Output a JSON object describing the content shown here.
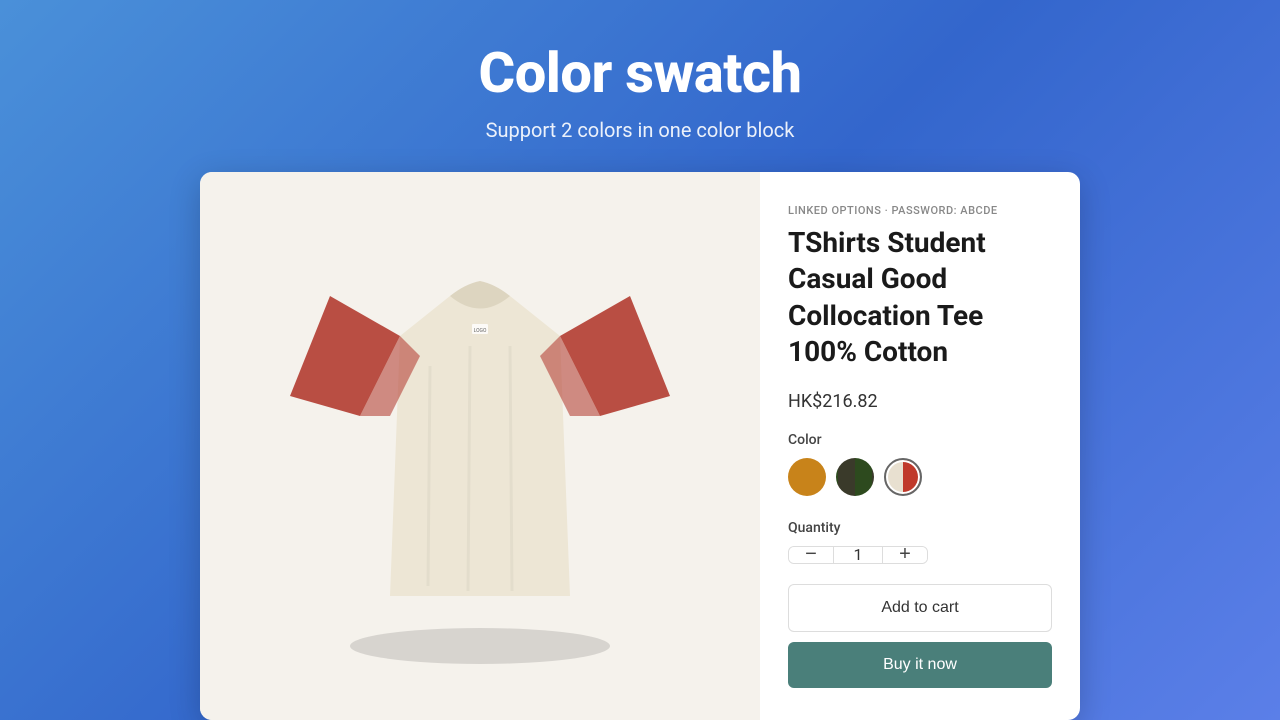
{
  "header": {
    "title": "Color swatch",
    "subtitle": "Support 2 colors in one color block"
  },
  "product": {
    "linked_label": "LINKED OPTIONS · PASSWORD: ABCDE",
    "title": "TShirts Student Casual Good Collocation Tee 100% Cotton",
    "price": "HK$216.82",
    "color_label": "Color",
    "quantity_label": "Quantity",
    "quantity_value": "1",
    "swatches": [
      {
        "id": "orange",
        "color": "#c8831a",
        "label": "Orange",
        "selected": false
      },
      {
        "id": "dark-green",
        "color": "dual-green",
        "label": "Dark Green",
        "selected": false
      },
      {
        "id": "red-cream",
        "color": "dual-red-cream",
        "label": "Red Cream",
        "selected": true
      }
    ],
    "add_to_cart_label": "Add to cart",
    "buy_now_label": "Buy it now",
    "qty_minus": "−",
    "qty_plus": "+"
  }
}
